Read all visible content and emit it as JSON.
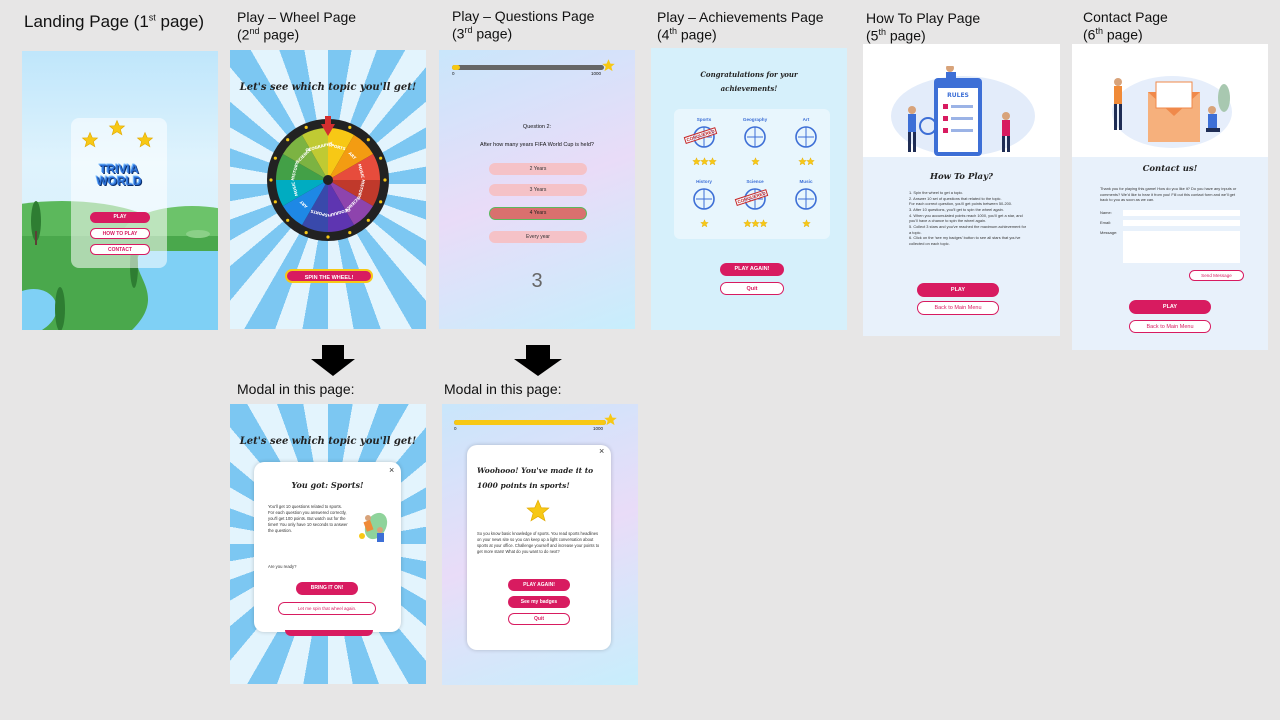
{
  "captions": {
    "landing": {
      "main": "Landing Page (1",
      "sup": "st",
      "end": " page)"
    },
    "wheel": {
      "line1": "Play – Wheel Page",
      "main": " (2",
      "sup": "nd",
      "end": " page)"
    },
    "questions": {
      "line1": "Play – Questions Page",
      "main": "(3",
      "sup": "rd",
      "end": " page)"
    },
    "achievements": {
      "line1": "Play – Achievements Page",
      "main": "(4",
      "sup": "th",
      "end": " page)"
    },
    "howto": {
      "line1": "How To Play Page",
      "main": "(5",
      "sup": "th",
      "end": " page)"
    },
    "contact": {
      "line1": "Contact Page",
      "main": "(6",
      "sup": "th",
      "end": " page)"
    },
    "modal_wheel": "Modal in this page:",
    "modal_questions": "Modal in this page:"
  },
  "landing": {
    "logo_line1": "TRIVIA",
    "logo_line2": "WORLD",
    "play": "PLAY",
    "how_to_play": "HOW TO PLAY",
    "contact": "CONTACT"
  },
  "wheel": {
    "title": "Let's see which topic you'll get!",
    "segments": [
      "SPORTS",
      "ART",
      "MUSIC",
      "HISTORY",
      "SCIENCE",
      "GEOGRAPHY",
      "SPORTS",
      "ART",
      "MUSIC",
      "HISTORY",
      "SCIENCE",
      "GEOGRAPHY"
    ],
    "spin_button": "SPIN THE WHEEL!"
  },
  "questions": {
    "progress_min": "0",
    "progress_max": "1000",
    "progress_fraction": 0.05,
    "question_label": "Question 2:",
    "question_text": "After how many years FIFA World Cup is held?",
    "answers": [
      "2 Years",
      "3 Years",
      "4 Years",
      "Every year"
    ],
    "timer": "3"
  },
  "achievements": {
    "title_line1": "Congratulations for your",
    "title_line2": "achievements!",
    "topics": [
      {
        "name": "Sports",
        "stamp": "CONQUERED"
      },
      {
        "name": "Geography",
        "stamp": ""
      },
      {
        "name": "Art",
        "stamp": ""
      },
      {
        "name": "History",
        "stamp": ""
      },
      {
        "name": "Science",
        "stamp": "CONQUERED"
      },
      {
        "name": "Music",
        "stamp": ""
      }
    ],
    "play_again": "PLAY AGAIN!",
    "quit": "Quit"
  },
  "howto": {
    "illustration_label": "RULES",
    "title": "How To Play?",
    "rules": [
      "1. Spin the wheel to get a topic.",
      "2. Answer 10 set of questions that related to the topic.",
      "For each correct question, you'll get points between 50-200.",
      "3. After 10 questions, you'll get to spin the wheel again.",
      "4. When you accumulated points reach 1000, you'll get a star, and you'll have a chance to spin the wheel again.",
      "5. Collect 3 stars and you've reached the maximum achievement for a topic.",
      "6. Click on the 'see my badges' button to see all stars that you've collected on each topic."
    ],
    "play": "PLAY",
    "back": "Back to Main Menu"
  },
  "contact": {
    "title": "Contact us!",
    "intro": "Thank you for playing this game! How do you like it? Do you have any inputs or comments? We'd like to hear it from you! Fill out this contact form and we'll get back to you as soon as we can.",
    "name_label": "Name:",
    "email_label": "Email:",
    "message_label": "Message:",
    "send": "Send Message",
    "play": "PLAY",
    "back": "Back to Main Menu"
  },
  "modal_wheel": {
    "close": "×",
    "title": "You got: Sports!",
    "body": "You'll get 10 questions related to sports. For each question you answered correctly, you'll get 100 points. But watch out for the timer! You only have 10 seconds to answer the question.",
    "ready": "Are you ready?",
    "bring_it": "BRING IT ON!",
    "spin_again": "Let me spin that wheel again."
  },
  "modal_questions": {
    "progress_min": "0",
    "progress_max": "1000",
    "progress_fraction": 1.0,
    "close": "×",
    "title_line1": "Woohooo! You've made it to",
    "title_line2": "1000 points in sports!",
    "body": "So you know basic knowledge of sports. You read sports headlines on your news site so you can keep up a light conversation about sports at your office. Challenge yourself and increase your points to get more stars! What do you want to do next?",
    "play_again": "PLAY AGAIN!",
    "badges": "See my badges",
    "quit": "Quit"
  },
  "colors": {
    "accent": "#d81b60",
    "sky": "#b8e4fa",
    "star": "#f7c815",
    "progress_track": "#666666",
    "light_panel": "#e8f1fb"
  }
}
